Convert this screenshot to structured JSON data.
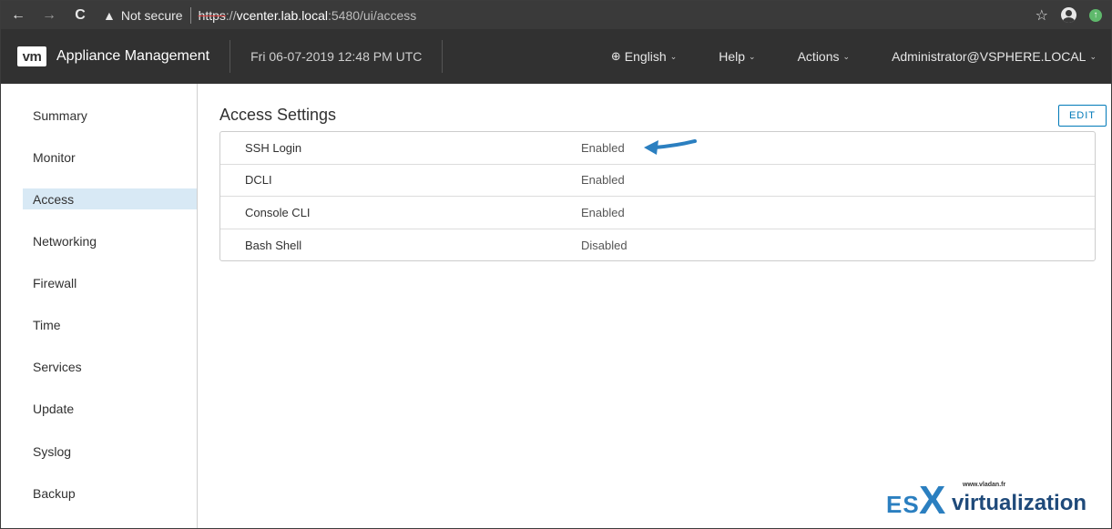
{
  "browser": {
    "back_icon": "←",
    "forward_icon": "→",
    "reload_icon": "C",
    "warning_icon": "▲",
    "security_label": "Not secure",
    "url_scheme": "https",
    "url_sep": "://",
    "url_host": "vcenter.lab.local",
    "url_rest": ":5480/ui/access",
    "star_icon": "☆",
    "ext_icon": "↑"
  },
  "header": {
    "logo": "vm",
    "title": "Appliance Management",
    "datetime": "Fri 06-07-2019 12:48 PM UTC",
    "globe_icon": "⊕",
    "language": "English",
    "help": "Help",
    "actions": "Actions",
    "user": "Administrator@VSPHERE.LOCAL",
    "chevron": "⌄"
  },
  "sidebar": {
    "items": [
      {
        "label": "Summary"
      },
      {
        "label": "Monitor"
      },
      {
        "label": "Access"
      },
      {
        "label": "Networking"
      },
      {
        "label": "Firewall"
      },
      {
        "label": "Time"
      },
      {
        "label": "Services"
      },
      {
        "label": "Update"
      },
      {
        "label": "Syslog"
      },
      {
        "label": "Backup"
      }
    ],
    "active": "Access"
  },
  "main": {
    "title": "Access Settings",
    "edit_label": "EDIT",
    "rows": [
      {
        "label": "SSH Login",
        "value": "Enabled"
      },
      {
        "label": "DCLI",
        "value": "Enabled"
      },
      {
        "label": "Console CLI",
        "value": "Enabled"
      },
      {
        "label": "Bash Shell",
        "value": "Disabled"
      }
    ]
  },
  "watermark": {
    "site": "www.vladan.fr",
    "es": "ES",
    "x": "X",
    "virtualization": "virtualization"
  },
  "colors": {
    "accent": "#0079b8",
    "active_bg": "#d8e9f5",
    "header_bg": "#313131",
    "arrow": "#2b7fc0"
  }
}
